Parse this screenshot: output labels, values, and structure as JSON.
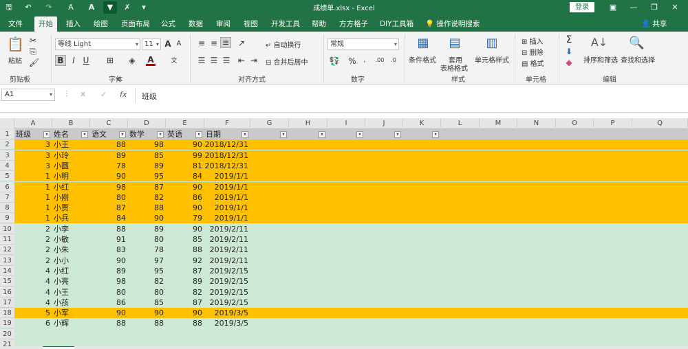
{
  "window": {
    "title": "成绩单.xlsx  -  Excel",
    "login": "登录",
    "share": "共享"
  },
  "quick_access": {
    "save": "🖫",
    "undo": "↶",
    "redo": "↷",
    "fill": "A",
    "font_color": "A",
    "filter": "▼",
    "clear": "✗",
    "more": "▾"
  },
  "tabs": [
    "文件",
    "开始",
    "插入",
    "绘图",
    "页面布局",
    "公式",
    "数据",
    "审阅",
    "视图",
    "开发工具",
    "帮助",
    "方方格子",
    "DIY工具箱",
    "操作说明搜索"
  ],
  "active_tab": "开始",
  "ribbon": {
    "clipboard": {
      "paste": "粘贴",
      "label": "剪贴板"
    },
    "font": {
      "name": "等线 Light",
      "size": "11",
      "bold": "B",
      "italic": "I",
      "underline": "U",
      "label": "字体"
    },
    "alignment": {
      "wrap": "自动换行",
      "merge": "合并后居中",
      "label": "对齐方式"
    },
    "number": {
      "format": "常规",
      "percent": "%",
      "label": "数字"
    },
    "styles": {
      "conditional": "条件格式",
      "table_l1": "套用",
      "table_l2": "表格格式",
      "cell_style": "单元格样式",
      "label": "样式"
    },
    "cells": {
      "insert": "插入",
      "delete": "删除",
      "format": "格式",
      "label": "单元格"
    },
    "editing": {
      "sort_filter": "排序和筛选",
      "find_select": "查找和选择",
      "label": "编辑"
    }
  },
  "formula_bar": {
    "name_box": "A1",
    "content": "班级"
  },
  "columns": [
    "A",
    "B",
    "C",
    "D",
    "E",
    "F",
    "G",
    "H",
    "I",
    "J",
    "K",
    "L",
    "M",
    "N",
    "O",
    "P",
    "Q"
  ],
  "headers": [
    "班级",
    "姓名",
    "语文",
    "数学",
    "英语",
    "日期"
  ],
  "rows": [
    {
      "n": "2",
      "c": [
        "3",
        "小王",
        "88",
        "98",
        "90",
        "2018/12/31"
      ],
      "hl": "orange"
    },
    {
      "n": "3",
      "c": [
        "3",
        "小玲",
        "89",
        "85",
        "99",
        "2018/12/31"
      ],
      "hl": "orange"
    },
    {
      "n": "4",
      "c": [
        "3",
        "小圆",
        "78",
        "89",
        "81",
        "2018/12/31"
      ],
      "hl": "orange"
    },
    {
      "n": "5",
      "c": [
        "1",
        "小明",
        "90",
        "95",
        "84",
        "2019/1/1"
      ],
      "hl": "orange"
    },
    {
      "n": "6",
      "c": [
        "1",
        "小红",
        "98",
        "87",
        "90",
        "2019/1/1"
      ],
      "hl": "orange"
    },
    {
      "n": "7",
      "c": [
        "1",
        "小刚",
        "80",
        "82",
        "86",
        "2019/1/1"
      ],
      "hl": "orange"
    },
    {
      "n": "8",
      "c": [
        "1",
        "小贾",
        "87",
        "88",
        "90",
        "2019/1/1"
      ],
      "hl": "orange"
    },
    {
      "n": "9",
      "c": [
        "1",
        "小兵",
        "84",
        "90",
        "79",
        "2019/1/1"
      ],
      "hl": "orange"
    },
    {
      "n": "10",
      "c": [
        "2",
        "小李",
        "88",
        "89",
        "90",
        "2019/2/11"
      ],
      "hl": "green"
    },
    {
      "n": "11",
      "c": [
        "2",
        "小敏",
        "91",
        "80",
        "85",
        "2019/2/11"
      ],
      "hl": "green"
    },
    {
      "n": "12",
      "c": [
        "2",
        "小朱",
        "83",
        "78",
        "88",
        "2019/2/11"
      ],
      "hl": "green"
    },
    {
      "n": "13",
      "c": [
        "2",
        "小小",
        "90",
        "97",
        "92",
        "2019/2/11"
      ],
      "hl": "green"
    },
    {
      "n": "14",
      "c": [
        "4",
        "小红",
        "89",
        "95",
        "87",
        "2019/2/15"
      ],
      "hl": "green"
    },
    {
      "n": "15",
      "c": [
        "4",
        "小亮",
        "98",
        "82",
        "89",
        "2019/2/15"
      ],
      "hl": "green"
    },
    {
      "n": "16",
      "c": [
        "4",
        "小王",
        "80",
        "80",
        "82",
        "2019/2/15"
      ],
      "hl": "green"
    },
    {
      "n": "17",
      "c": [
        "4",
        "小孩",
        "86",
        "85",
        "87",
        "2019/2/15"
      ],
      "hl": "green"
    },
    {
      "n": "18",
      "c": [
        "5",
        "小军",
        "90",
        "90",
        "90",
        "2019/3/5"
      ],
      "hl": "orange"
    },
    {
      "n": "19",
      "c": [
        "6",
        "小辉",
        "88",
        "88",
        "88",
        "2019/3/5"
      ],
      "hl": "green"
    },
    {
      "n": "20",
      "c": [
        "",
        "",
        "",
        "",
        "",
        ""
      ],
      "hl": "green"
    },
    {
      "n": "21",
      "c": [
        "",
        "",
        "",
        "",
        "",
        ""
      ],
      "hl": "green"
    }
  ],
  "colors": {
    "excel_green": "#217346",
    "highlight_orange": "#ffc000",
    "highlight_green": "#cde8d5"
  }
}
